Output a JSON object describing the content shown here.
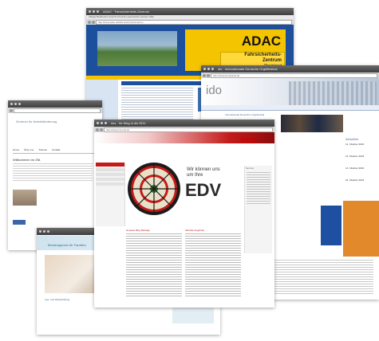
{
  "windows": {
    "adac": {
      "title": "ADAC · Fahrsicherheits-Zentrum",
      "menu": "Ablage  Bearbeiten  Ansicht  Chronik  Lesezeichen  Fenster  Hilfe",
      "url": "http://www.adac.de/fahrsicherheitszentrum",
      "logo": "ADAC",
      "sign_line1": "Fahrsicherheits-",
      "sign_line2": "Zentrum",
      "sign_line3": "Rheinland",
      "content_title": "Herzlich willkommen im Fahrsicherheitszentrum"
    },
    "ido": {
      "title": "ido · Internationale Deutsche Orgelfestival",
      "url": "http://www.ido-festival.de",
      "logo": "ido",
      "banner": "Internationale Deutsche Orgelfestival",
      "news_title": "Aktuelles",
      "dates": [
        "12. Oktober 2016",
        "13. Oktober 2016",
        "14. Oktober 2016",
        "16. Oktober 2016"
      ]
    },
    "left": {
      "title": "Zentrum für Arbeitsförderung",
      "heading": "Willkommen im ZfA",
      "tabs": [
        "Home",
        "Über uns",
        "Themen",
        "Kontakt"
      ]
    },
    "ims": {
      "title": "ims · Ihr Weg in die EDV",
      "url": "http://www.ims-edv.de",
      "logo": "ims",
      "headline_line1": "Wir können uns",
      "headline_line2": "um Ihre",
      "big_word": "EDV",
      "col1_title": "Neueste Blog Beiträge",
      "col2_title": "Aktuelle Angebote",
      "col3_title": "Service"
    },
    "bottom": {
      "heading": "Beratungsnetz für Familien",
      "card1": "Aus- und Weiterbildung",
      "card2": "Netzwerk & Kooperation"
    }
  }
}
